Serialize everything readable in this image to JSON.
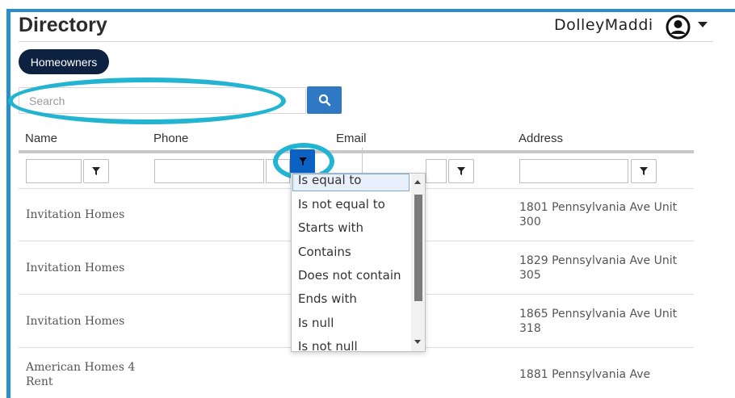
{
  "header": {
    "title": "Directory",
    "username": "DolleyMaddi"
  },
  "tabs": {
    "homeowners": "Homeowners"
  },
  "search": {
    "placeholder": "Search"
  },
  "columns": {
    "name": "Name",
    "phone": "Phone",
    "email": "Email",
    "address": "Address"
  },
  "rows": [
    {
      "name": "Invitation Homes",
      "address": "1801 Pennsylvania Ave Unit 300"
    },
    {
      "name": "Invitation Homes",
      "address": "1829 Pennsylvania Ave Unit 305"
    },
    {
      "name": "Invitation Homes",
      "address": "1865 Pennsylvania Ave Unit 318"
    },
    {
      "name": "American Homes 4 Rent",
      "address": "1881 Pennsylvania Ave"
    }
  ],
  "filter_options": [
    "Is equal to",
    "Is not equal to",
    "Starts with",
    "Contains",
    "Does not contain",
    "Ends with",
    "Is null",
    "Is not null"
  ],
  "colors": {
    "accent": "#2f78c4",
    "annotation": "#23b4d2",
    "pill": "#0d2240",
    "frame": "#2a8fc8"
  },
  "icons": {
    "search": "search-icon",
    "filter": "filter-icon",
    "user": "user-avatar-icon",
    "menu": "caret-down-icon"
  }
}
